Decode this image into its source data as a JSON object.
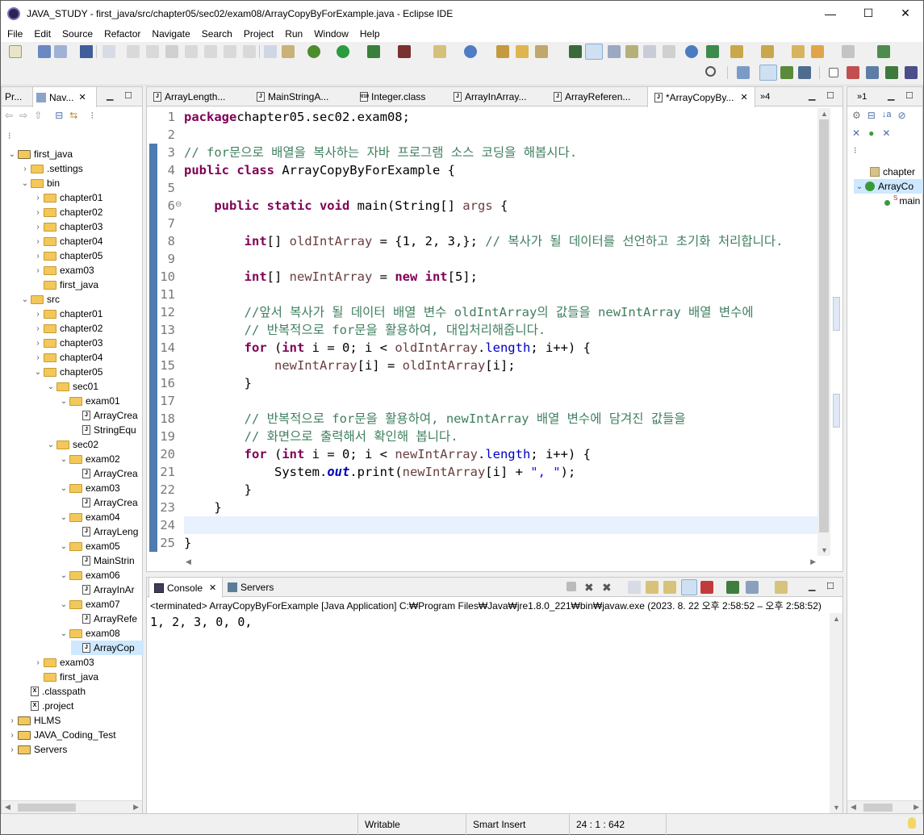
{
  "window": {
    "title": "JAVA_STUDY - first_java/src/chapter05/sec02/exam08/ArrayCopyByForExample.java - Eclipse IDE",
    "minimize": "—",
    "maximize": "☐",
    "close": "✕"
  },
  "menu": [
    "File",
    "Edit",
    "Source",
    "Refactor",
    "Navigate",
    "Search",
    "Project",
    "Run",
    "Window",
    "Help"
  ],
  "left_panel": {
    "tabs": [
      "Pr...",
      "Nav..."
    ],
    "tree": [
      {
        "label": "first_java",
        "depth": 0,
        "arrow": "⌄",
        "icon": "project"
      },
      {
        "label": ".settings",
        "depth": 1,
        "arrow": "›",
        "icon": "folder"
      },
      {
        "label": "bin",
        "depth": 1,
        "arrow": "⌄",
        "icon": "folder"
      },
      {
        "label": "chapter01",
        "depth": 2,
        "arrow": "›",
        "icon": "folder"
      },
      {
        "label": "chapter02",
        "depth": 2,
        "arrow": "›",
        "icon": "folder"
      },
      {
        "label": "chapter03",
        "depth": 2,
        "arrow": "›",
        "icon": "folder"
      },
      {
        "label": "chapter04",
        "depth": 2,
        "arrow": "›",
        "icon": "folder"
      },
      {
        "label": "chapter05",
        "depth": 2,
        "arrow": "›",
        "icon": "folder"
      },
      {
        "label": "exam03",
        "depth": 2,
        "arrow": "›",
        "icon": "folder"
      },
      {
        "label": "first_java",
        "depth": 2,
        "arrow": "",
        "icon": "folder"
      },
      {
        "label": "src",
        "depth": 1,
        "arrow": "⌄",
        "icon": "folder"
      },
      {
        "label": "chapter01",
        "depth": 2,
        "arrow": "›",
        "icon": "folder"
      },
      {
        "label": "chapter02",
        "depth": 2,
        "arrow": "›",
        "icon": "folder"
      },
      {
        "label": "chapter03",
        "depth": 2,
        "arrow": "›",
        "icon": "folder"
      },
      {
        "label": "chapter04",
        "depth": 2,
        "arrow": "›",
        "icon": "folder"
      },
      {
        "label": "chapter05",
        "depth": 2,
        "arrow": "⌄",
        "icon": "folder"
      },
      {
        "label": "sec01",
        "depth": 3,
        "arrow": "⌄",
        "icon": "folder"
      },
      {
        "label": "exam01",
        "depth": 4,
        "arrow": "⌄",
        "icon": "folder"
      },
      {
        "label": "ArrayCrea",
        "depth": 5,
        "arrow": "",
        "icon": "java"
      },
      {
        "label": "StringEqu",
        "depth": 5,
        "arrow": "",
        "icon": "java"
      },
      {
        "label": "sec02",
        "depth": 3,
        "arrow": "⌄",
        "icon": "folder"
      },
      {
        "label": "exam02",
        "depth": 4,
        "arrow": "⌄",
        "icon": "folder"
      },
      {
        "label": "ArrayCrea",
        "depth": 5,
        "arrow": "",
        "icon": "java"
      },
      {
        "label": "exam03",
        "depth": 4,
        "arrow": "⌄",
        "icon": "folder"
      },
      {
        "label": "ArrayCrea",
        "depth": 5,
        "arrow": "",
        "icon": "java"
      },
      {
        "label": "exam04",
        "depth": 4,
        "arrow": "⌄",
        "icon": "folder"
      },
      {
        "label": "ArrayLeng",
        "depth": 5,
        "arrow": "",
        "icon": "java"
      },
      {
        "label": "exam05",
        "depth": 4,
        "arrow": "⌄",
        "icon": "folder"
      },
      {
        "label": "MainStrin",
        "depth": 5,
        "arrow": "",
        "icon": "java"
      },
      {
        "label": "exam06",
        "depth": 4,
        "arrow": "⌄",
        "icon": "folder"
      },
      {
        "label": "ArrayInAr",
        "depth": 5,
        "arrow": "",
        "icon": "java"
      },
      {
        "label": "exam07",
        "depth": 4,
        "arrow": "⌄",
        "icon": "folder"
      },
      {
        "label": "ArrayRefe",
        "depth": 5,
        "arrow": "",
        "icon": "java"
      },
      {
        "label": "exam08",
        "depth": 4,
        "arrow": "⌄",
        "icon": "folder"
      },
      {
        "label": "ArrayCop",
        "depth": 5,
        "arrow": "",
        "icon": "java",
        "selected": true
      },
      {
        "label": "exam03",
        "depth": 2,
        "arrow": "›",
        "icon": "folder"
      },
      {
        "label": "first_java",
        "depth": 2,
        "arrow": "",
        "icon": "folder"
      },
      {
        "label": ".classpath",
        "depth": 1,
        "arrow": "",
        "icon": "xml"
      },
      {
        "label": ".project",
        "depth": 1,
        "arrow": "",
        "icon": "xml"
      },
      {
        "label": "HLMS",
        "depth": 0,
        "arrow": "›",
        "icon": "project"
      },
      {
        "label": "JAVA_Coding_Test",
        "depth": 0,
        "arrow": "›",
        "icon": "project"
      },
      {
        "label": "Servers",
        "depth": 0,
        "arrow": "›",
        "icon": "project"
      }
    ]
  },
  "editor": {
    "tabs": [
      "ArrayLength...",
      "MainStringA...",
      "Integer.class",
      "ArrayInArray...",
      "ArrayReferen...",
      "*ArrayCopyBy..."
    ],
    "overflow": "»4",
    "lines": [
      {
        "n": "1",
        "segs": [
          [
            "kw",
            "package"
          ],
          [
            "",
            "chapter05.sec02.exam08;"
          ]
        ]
      },
      {
        "n": "2",
        "segs": []
      },
      {
        "n": "3",
        "segs": [
          [
            "cm",
            "// for문으로 배열을 복사하는 자바 프로그램 소스 코딩을 해봅시다."
          ]
        ]
      },
      {
        "n": "4",
        "segs": [
          [
            "kw",
            "public class"
          ],
          [
            "",
            " ArrayCopyByForExample {"
          ]
        ]
      },
      {
        "n": "5",
        "segs": []
      },
      {
        "n": "6",
        "segs": [
          [
            "",
            "    "
          ],
          [
            "kw",
            "public static void"
          ],
          [
            "",
            " main(String[] "
          ],
          [
            "par",
            "args"
          ],
          [
            "",
            " {"
          ]
        ]
      },
      {
        "n": "7",
        "segs": []
      },
      {
        "n": "8",
        "segs": [
          [
            "",
            "        "
          ],
          [
            "kw",
            "int"
          ],
          [
            "",
            "[] "
          ],
          [
            "par",
            "oldIntArray"
          ],
          [
            "",
            " = {1, 2, 3,}; "
          ],
          [
            "cm",
            "// 복사가 될 데이터를 선언하고 초기화 처리합니다."
          ]
        ]
      },
      {
        "n": "9",
        "segs": []
      },
      {
        "n": "10",
        "segs": [
          [
            "",
            "        "
          ],
          [
            "kw",
            "int"
          ],
          [
            "",
            "[] "
          ],
          [
            "par",
            "newIntArray"
          ],
          [
            "",
            " = "
          ],
          [
            "kw",
            "new int"
          ],
          [
            "",
            "[5];"
          ]
        ]
      },
      {
        "n": "11",
        "segs": []
      },
      {
        "n": "12",
        "segs": [
          [
            "",
            "        "
          ],
          [
            "cm",
            "//앞서 복사가 될 데이터 배열 변수 oldIntArray의 값들을 newIntArray 배열 변수에"
          ]
        ]
      },
      {
        "n": "13",
        "segs": [
          [
            "",
            "        "
          ],
          [
            "cm",
            "// 반복적으로 for문을 활용하여, 대입처리해줍니다."
          ]
        ]
      },
      {
        "n": "14",
        "segs": [
          [
            "",
            "        "
          ],
          [
            "kw",
            "for"
          ],
          [
            "",
            " ("
          ],
          [
            "kw",
            "int"
          ],
          [
            "",
            " i = 0; i < "
          ],
          [
            "par",
            "oldIntArray"
          ],
          [
            "",
            "."
          ],
          [
            "fd",
            "length"
          ],
          [
            "",
            "; i++) {"
          ]
        ]
      },
      {
        "n": "15",
        "segs": [
          [
            "",
            "            "
          ],
          [
            "par",
            "newIntArray"
          ],
          [
            "",
            "[i] = "
          ],
          [
            "par",
            "oldIntArray"
          ],
          [
            "",
            "[i];"
          ]
        ]
      },
      {
        "n": "16",
        "segs": [
          [
            "",
            "        }"
          ]
        ]
      },
      {
        "n": "17",
        "segs": []
      },
      {
        "n": "18",
        "segs": [
          [
            "",
            "        "
          ],
          [
            "cm",
            "// 반복적으로 for문을 활용하여, newIntArray 배열 변수에 담겨진 값들을"
          ]
        ]
      },
      {
        "n": "19",
        "segs": [
          [
            "",
            "        "
          ],
          [
            "cm",
            "// 화면으로 출력해서 확인해 봅니다."
          ]
        ]
      },
      {
        "n": "20",
        "segs": [
          [
            "",
            "        "
          ],
          [
            "kw",
            "for"
          ],
          [
            "",
            " ("
          ],
          [
            "kw",
            "int"
          ],
          [
            "",
            " i = 0; i < "
          ],
          [
            "par",
            "newIntArray"
          ],
          [
            "",
            "."
          ],
          [
            "fd",
            "length"
          ],
          [
            "",
            "; i++) {"
          ]
        ]
      },
      {
        "n": "21",
        "segs": [
          [
            "",
            "            System."
          ],
          [
            "sf",
            "out"
          ],
          [
            "",
            ".print("
          ],
          [
            "par",
            "newIntArray"
          ],
          [
            "",
            "[i] + "
          ],
          [
            "st",
            "\", \""
          ],
          [
            "",
            ");"
          ]
        ]
      },
      {
        "n": "22",
        "segs": [
          [
            "",
            "        }"
          ]
        ]
      },
      {
        "n": "23",
        "segs": [
          [
            "",
            "    }"
          ]
        ]
      },
      {
        "n": "24",
        "segs": []
      },
      {
        "n": "25",
        "segs": [
          [
            "",
            "}"
          ]
        ]
      }
    ]
  },
  "outline": {
    "overflow": "»1",
    "items": [
      "chapter",
      "ArrayCo",
      "main"
    ]
  },
  "console": {
    "tabs": [
      "Console",
      "Servers"
    ],
    "header": "<terminated> ArrayCopyByForExample [Java Application] C:₩Program Files₩Java₩jre1.8.0_221₩bin₩javaw.exe  (2023. 8. 22 오후 2:58:52 – 오후 2:58:52)",
    "output": "1, 2, 3, 0, 0, "
  },
  "status": {
    "writable": "Writable",
    "insert_mode": "Smart Insert",
    "position": "24 : 1 : 642"
  },
  "colors": {
    "keyword": "#7f0055",
    "comment": "#3f7f5f",
    "field": "#0000c0",
    "string": "#2a00ff",
    "current_line": "#e8f2fe",
    "selection": "#cde8ff"
  }
}
